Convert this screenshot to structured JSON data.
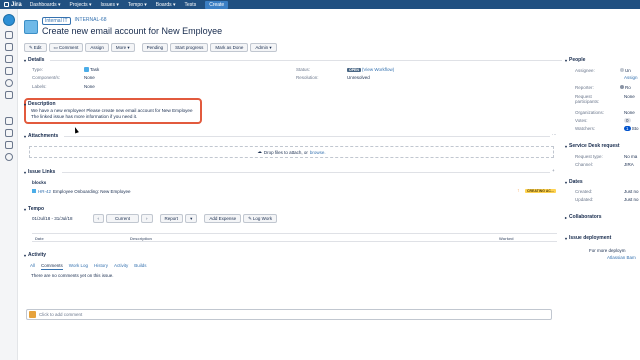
{
  "topnav": {
    "logo": "Jira",
    "items": [
      "Dashboards ▾",
      "Projects ▾",
      "Issues ▾",
      "Tempo ▾",
      "Boards ▾",
      "Tests"
    ],
    "create_label": "Create"
  },
  "breadcrumb": {
    "project": "Internal IT",
    "issue_key": "INTERNAL-68"
  },
  "issue": {
    "title": "Create new email account for New Employee"
  },
  "toolbar": {
    "edit": "Edit",
    "comment": "Comment",
    "assign": "Assign",
    "more": "More ▾",
    "pending": "Pending",
    "start_progress": "Start progress",
    "mark_done": "Mark as Done",
    "admin": "Admin ▾"
  },
  "details": {
    "heading": "Details",
    "type_label": "Type:",
    "type_value": "Task",
    "components_label": "Component/s:",
    "components_value": "None",
    "labels_label": "Labels:",
    "labels_value": "None",
    "status_label": "Status:",
    "status_value": "OPEN",
    "view_workflow": "(View Workflow)",
    "resolution_label": "Resolution:",
    "resolution_value": "Unresolved"
  },
  "description": {
    "heading": "Description",
    "line1": "We have a new employee! Please create new email account for New Employee",
    "line2": "The linked issue has more information if you need it."
  },
  "attachments": {
    "heading": "Attachments",
    "drop_text": "Drop files to attach, or",
    "browse": "browse."
  },
  "issue_links": {
    "heading": "Issue Links",
    "relation": "blocks",
    "linked_key": "HR-42",
    "linked_summary": "Employee Onboarding: New Employee",
    "linked_status": "CREATING AC..."
  },
  "tempo": {
    "heading": "Tempo",
    "date_range": "01/Jul/18 - 31/Jul/18",
    "current": "Current",
    "report": "Report",
    "add_expense": "Add Expense",
    "log_work": "Log Work",
    "col_date": "Date",
    "col_description": "Description",
    "col_worked": "Worked"
  },
  "activity": {
    "heading": "Activity",
    "tabs": [
      "All",
      "Comments",
      "Work Log",
      "History",
      "Activity",
      "Builds"
    ],
    "no_comments": "There are no comments yet on this issue.",
    "comment_placeholder": "Click to add comment"
  },
  "right_panel": {
    "people_heading": "People",
    "assignee_label": "Assignee:",
    "assignee_value": "Un",
    "assign_link": "Assign",
    "reporter_label": "Reporter:",
    "reporter_value": "Ro",
    "request_participants_label": "Request participants:",
    "request_participants_value": "None",
    "organizations_label": "Organizations:",
    "organizations_value": "None",
    "votes_label": "Votes:",
    "votes_value": "0",
    "watchers_label": "Watchers:",
    "watchers_value": "1",
    "watchers_suffix": "Sto",
    "sd_heading": "Service Desk request",
    "request_type_label": "Request type:",
    "request_type_value": "No ma",
    "channel_label": "Channel:",
    "channel_value": "JIRA",
    "dates_heading": "Dates",
    "created_label": "Created:",
    "created_value": "Just no",
    "updated_label": "Updated:",
    "updated_value": "Just no",
    "collaborators_heading": "Collaborators",
    "deployment_heading": "Issue deployment",
    "deployment_text": "For more deploym",
    "deployment_link": "Atlassian Bam"
  }
}
